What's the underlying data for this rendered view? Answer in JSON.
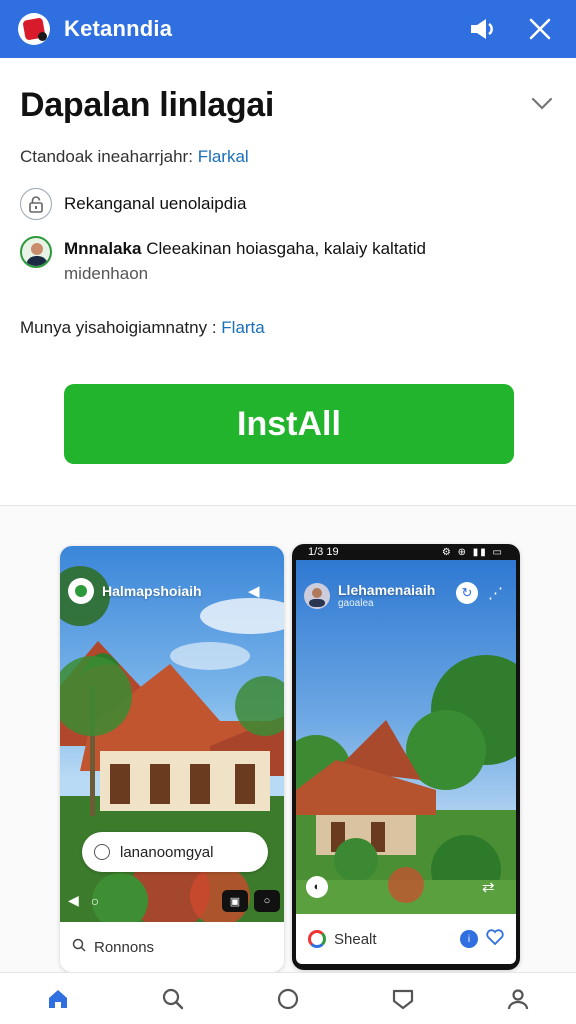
{
  "topbar": {
    "app_name": "Ketanndia"
  },
  "header": {
    "title": "Dapalan linlagai",
    "developer_prefix": "Ctandoak ineaharrjahr:",
    "developer_link": "Flarkal"
  },
  "details": {
    "rating_label": "Rekanganal uenolaipdia",
    "reviewer_name": "Mnnalaka",
    "reviewer_text": "Cleeakinan hoiasgaha, kalaiy kaltatid",
    "reviewer_sub": "midenhaon",
    "info_prefix": "Munya yisahoigiamnatny :",
    "info_link": "Flarta"
  },
  "install_label": "InstAll",
  "screenshots": [
    {
      "app_title": "Halmapshoiaih",
      "pill_text": "lananoomgyal",
      "footer_text": "Ronnons",
      "icons": [
        "speaker-icon",
        "gallery-icon",
        "circle-icon"
      ]
    },
    {
      "status_time": "1/3 19",
      "status_icons": "⚙ ⊕ ▮▮ ▭",
      "app_title": "Llehamenaiaih",
      "app_subtitle": "gaoalea",
      "footer_text": "Shealt",
      "icons": [
        "swirl-icon",
        "share-icon",
        "gallery-icon"
      ]
    }
  ],
  "nav": {
    "items": [
      "home-icon",
      "search-icon",
      "circle-icon",
      "shield-icon",
      "profile-icon"
    ],
    "accent": "#2f6fe0"
  },
  "colors": {
    "brand": "#2f6fe0",
    "install": "#21b42c",
    "link": "#1a6fb8"
  }
}
